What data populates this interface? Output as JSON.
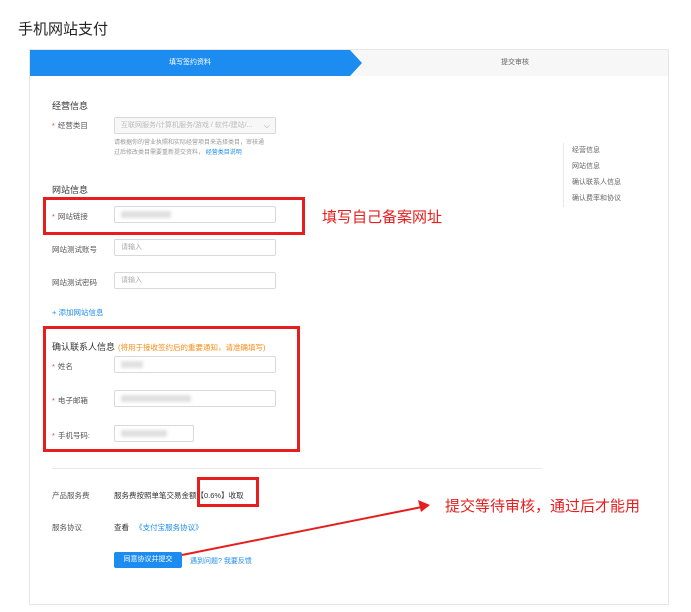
{
  "page": {
    "title": "手机网站支付"
  },
  "steps": [
    {
      "label": "填写签约资料",
      "active": true
    },
    {
      "label": "提交审核",
      "active": false
    }
  ],
  "business": {
    "section_title": "经营信息",
    "category_label": "经营类目",
    "category_value": "互联网服务/计算机服务/游戏 / 软件/建站/...",
    "help_line1": "请根据你的营业执照和实际经营项目来选择类目，审核通",
    "help_line2": "过后修改类目需要重新提交资料，",
    "help_link": "经营类目说明"
  },
  "website": {
    "section_title": "网站信息",
    "url_label": "网站链接",
    "test_account_label": "网站测试账号",
    "test_account_placeholder": "请输入",
    "test_password_label": "网站测试密码",
    "test_password_placeholder": "请输入",
    "add_link": "+ 添加网站信息"
  },
  "contact": {
    "section_title": "确认联系人信息",
    "section_note": "(将用于接收签约后的重要通知，请准确填写)",
    "name_label": "姓名",
    "email_label": "电子邮箱",
    "phone_label": "手机号码:"
  },
  "fee": {
    "label": "产品服务费",
    "text": "服务费按照单笔交易金额",
    "rate": "【0.6%】收取"
  },
  "agreement": {
    "label": "服务协议",
    "prefix": "查看",
    "link": "《支付宝服务协议》"
  },
  "actions": {
    "submit_label": "同意协议并提交",
    "feedback_link": "遇到问题? 我要反馈"
  },
  "side_nav": [
    "经营信息",
    "网站信息",
    "确认联系人信息",
    "确认费率和协议"
  ],
  "annotations": {
    "url_note": "填写自己备案网址",
    "submit_note": "提交等待审核，通过后才能用"
  },
  "colors": {
    "primary": "#1d8cf0",
    "annotation_red": "#e61e1e",
    "required": "#f04134",
    "note_orange": "#fa8c16"
  }
}
